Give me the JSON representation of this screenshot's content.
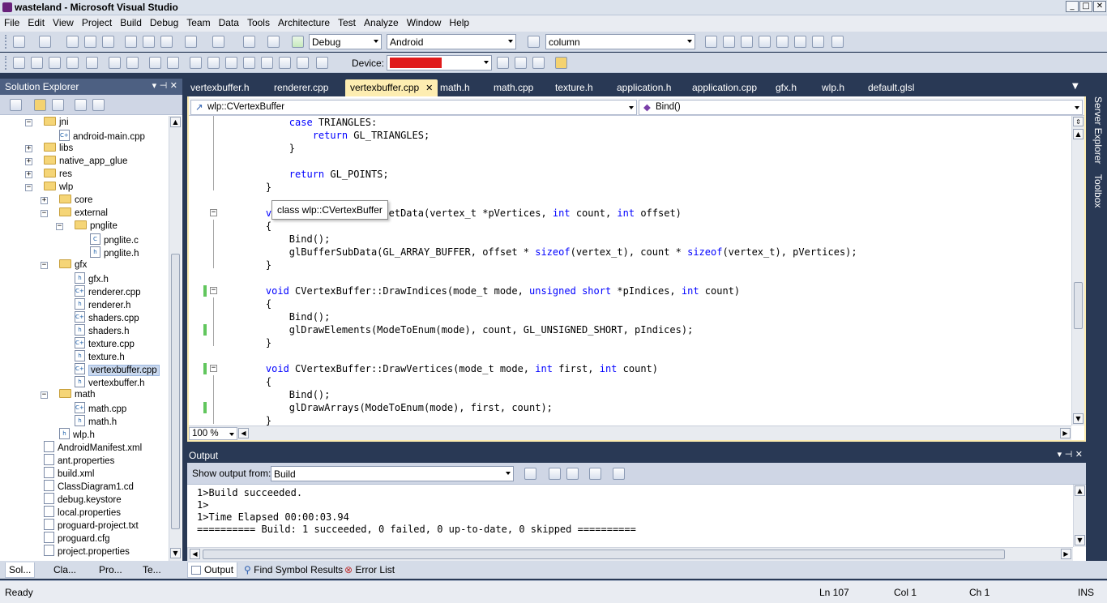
{
  "window": {
    "title": "wasteland - Microsoft Visual Studio",
    "min": "_",
    "max": "□",
    "close": "✕"
  },
  "menu": [
    "File",
    "Edit",
    "View",
    "Project",
    "Build",
    "Debug",
    "Team",
    "Data",
    "Tools",
    "Architecture",
    "Test",
    "Analyze",
    "Window",
    "Help"
  ],
  "toolbar": {
    "configuration": "Debug",
    "platform": "Android",
    "find_value": "column",
    "device_label": "Device:",
    "device_color": "#e01b1b"
  },
  "solution_explorer": {
    "title": "Solution Explorer",
    "pin": "▾ ⊣ ✕",
    "tree": [
      {
        "label": "jni",
        "type": "folder",
        "exp": "−"
      },
      {
        "label": "android-main.cpp",
        "type": "cpp"
      },
      {
        "label": "libs",
        "type": "folder",
        "exp": "+"
      },
      {
        "label": "native_app_glue",
        "type": "folder",
        "exp": "+"
      },
      {
        "label": "res",
        "type": "folder",
        "exp": "+"
      },
      {
        "label": "wlp",
        "type": "folder",
        "exp": "−"
      },
      {
        "label": "core",
        "type": "folder",
        "exp": "+"
      },
      {
        "label": "external",
        "type": "folder",
        "exp": "−"
      },
      {
        "label": "pnglite",
        "type": "folder",
        "exp": "−"
      },
      {
        "label": "pnglite.c",
        "type": "c"
      },
      {
        "label": "pnglite.h",
        "type": "h"
      },
      {
        "label": "gfx",
        "type": "folder",
        "exp": "−"
      },
      {
        "label": "gfx.h",
        "type": "h"
      },
      {
        "label": "renderer.cpp",
        "type": "cpp"
      },
      {
        "label": "renderer.h",
        "type": "h"
      },
      {
        "label": "shaders.cpp",
        "type": "cpp"
      },
      {
        "label": "shaders.h",
        "type": "h"
      },
      {
        "label": "texture.cpp",
        "type": "cpp"
      },
      {
        "label": "texture.h",
        "type": "h"
      },
      {
        "label": "vertexbuffer.cpp",
        "type": "cpp"
      },
      {
        "label": "vertexbuffer.h",
        "type": "h"
      },
      {
        "label": "math",
        "type": "folder",
        "exp": "−"
      },
      {
        "label": "math.cpp",
        "type": "cpp"
      },
      {
        "label": "math.h",
        "type": "h"
      },
      {
        "label": "wlp.h",
        "type": "h"
      },
      {
        "label": "AndroidManifest.xml",
        "type": "file"
      },
      {
        "label": "ant.properties",
        "type": "file"
      },
      {
        "label": "build.xml",
        "type": "file"
      },
      {
        "label": "ClassDiagram1.cd",
        "type": "file"
      },
      {
        "label": "debug.keystore",
        "type": "file"
      },
      {
        "label": "local.properties",
        "type": "file"
      },
      {
        "label": "proguard-project.txt",
        "type": "file"
      },
      {
        "label": "proguard.cfg",
        "type": "file"
      },
      {
        "label": "project.properties",
        "type": "file"
      }
    ],
    "bottom_tabs": [
      "Sol...",
      "Cla...",
      "Pro...",
      "Te..."
    ]
  },
  "doc_tabs": [
    "vertexbuffer.h",
    "renderer.cpp",
    "vertexbuffer.cpp",
    "math.h",
    "math.cpp",
    "texture.h",
    "application.h",
    "application.cpp",
    "gfx.h",
    "wlp.h",
    "default.glsl"
  ],
  "editor": {
    "scope": "wlp::CVertexBuffer",
    "member": "Bind()",
    "zoom": "100 %",
    "tooltip": "class wlp::CVertexBuffer",
    "lines": [
      "        case TRIANGLES:",
      "            return GL_TRIANGLES;",
      "        }",
      "",
      "        return GL_POINTS;",
      "    }",
      "",
      "    void CVertexBuffer::SetData(vertex_t *pVertices, int count, int offset)",
      "    {",
      "        Bind();",
      "        glBufferSubData(GL_ARRAY_BUFFER, offset * sizeof(vertex_t), count * sizeof(vertex_t), pVertices);",
      "    }",
      "",
      "    void CVertexBuffer::DrawIndices(mode_t mode, unsigned short *pIndices, int count)",
      "    {",
      "        Bind();",
      "        glDrawElements(ModeToEnum(mode), count, GL_UNSIGNED_SHORT, pIndices);",
      "    }",
      "",
      "    void CVertexBuffer::DrawVertices(mode_t mode, int first, int count)",
      "    {",
      "        Bind();",
      "        glDrawArrays(ModeToEnum(mode), first, count);",
      "    }"
    ]
  },
  "output": {
    "title": "Output",
    "show_from_label": "Show output from:",
    "source": "Build",
    "lines": [
      "1>Build succeeded.",
      "1>",
      "1>Time Elapsed 00:00:03.94",
      "========== Build: 1 succeeded, 0 failed, 0 up-to-date, 0 skipped =========="
    ]
  },
  "bottom_tabs": [
    "Output",
    "Find Symbol Results",
    "Error List"
  ],
  "right_bar": [
    "Server Explorer",
    "Toolbox"
  ],
  "status": {
    "ready": "Ready",
    "ln": "Ln 107",
    "col": "Col 1",
    "ch": "Ch 1",
    "ins": "INS"
  }
}
